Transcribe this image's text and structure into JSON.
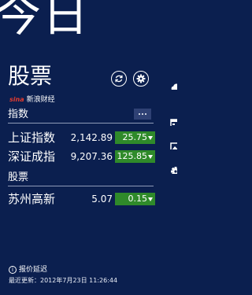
{
  "header": {
    "hero_text": "今日",
    "title": "股票"
  },
  "brand": {
    "sina_text": "sina",
    "name": "新浪财经"
  },
  "sections": {
    "index_title": "指数",
    "stocks_title": "股票"
  },
  "rows": [
    {
      "name": "上证指数",
      "price": "2,142.89",
      "change": "25.75"
    },
    {
      "name": "深证成指",
      "price": "9,207.36",
      "change": "125.85"
    },
    {
      "name": "苏州高新",
      "price": "5.07",
      "change": "0.15"
    }
  ],
  "footer": {
    "note": "报价延迟",
    "updated": "最近更新：2012年7月23日 11:26:44"
  },
  "icons": {
    "refresh": "refresh-icon",
    "settings": "gear-icon",
    "more": "more-dots-icon",
    "cloud": "cloud-icon",
    "calendar": "calendar-icon",
    "photo": "photo-icon",
    "settings_side": "gear-icon",
    "info": "info-icon"
  },
  "colors": {
    "background": "#0b1f4f",
    "change_badge": "#2f8a2a",
    "sina_red": "#e23b2e"
  }
}
